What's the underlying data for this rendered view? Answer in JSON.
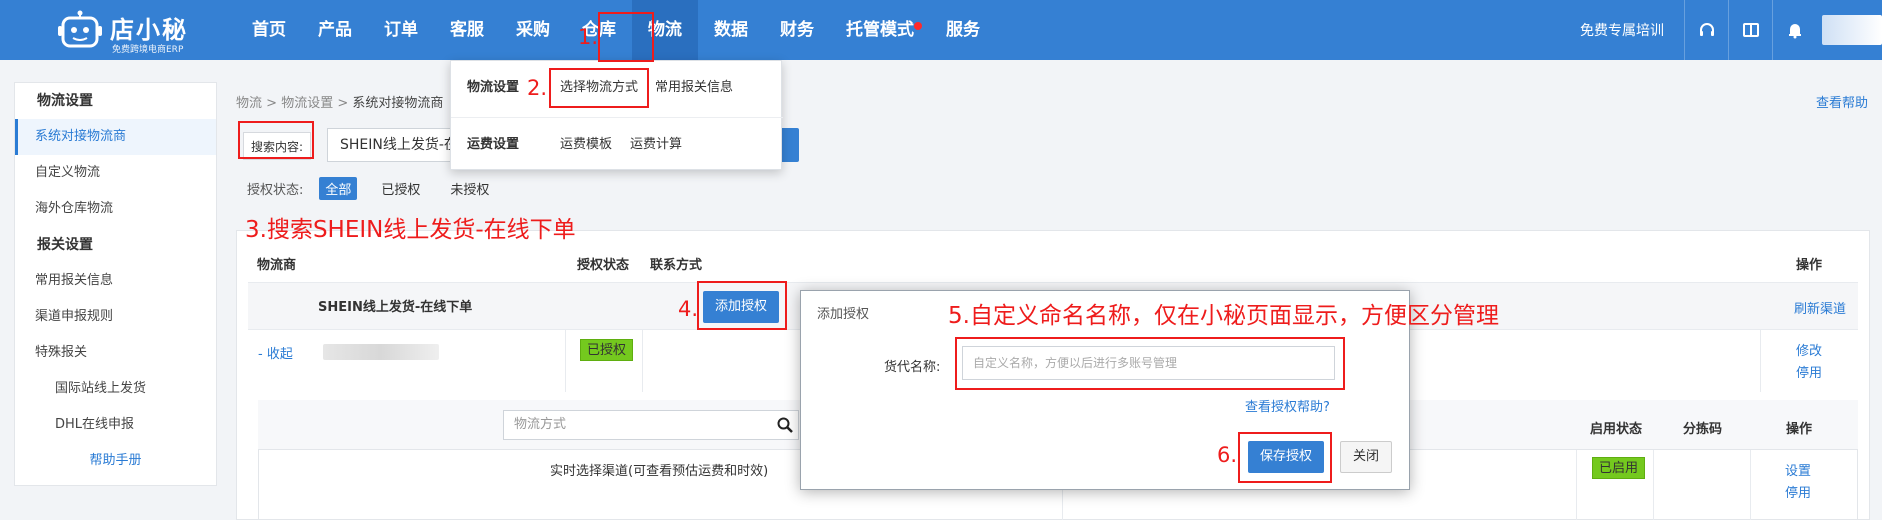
{
  "header": {
    "logo_text": "店小秘",
    "logo_sub": "免费跨境电商ERP",
    "nav": [
      "首页",
      "产品",
      "订单",
      "客服",
      "采购",
      "仓库",
      "物流",
      "数据",
      "财务",
      "托管模式",
      "服务"
    ],
    "active_nav": "物流",
    "free_training": "免费专属培训"
  },
  "dropdown": {
    "group1": "物流设置",
    "group1_items": [
      "选择物流方式",
      "常用报关信息"
    ],
    "group2": "运费设置",
    "group2_items": [
      "运费模板",
      "运费计算"
    ]
  },
  "sidebar": {
    "group1": "物流设置",
    "items1": [
      "系统对接物流商",
      "自定义物流",
      "海外仓库物流"
    ],
    "group2": "报关设置",
    "items2": [
      "常用报关信息",
      "渠道申报规则",
      "特殊报关"
    ],
    "subitems": [
      "国际站线上发货",
      "DHL在线申报"
    ],
    "help": "帮助手册"
  },
  "breadcrumb": [
    "物流",
    "物流设置",
    "系统对接物流商"
  ],
  "view_help": "查看帮助",
  "search": {
    "label": "搜索内容:",
    "value": "SHEIN线上发货-在"
  },
  "auth_filter": {
    "label": "授权状态:",
    "options": [
      "全部",
      "已授权",
      "未授权"
    ]
  },
  "table": {
    "headers": [
      "物流商",
      "授权状态",
      "联系方式",
      "操作"
    ],
    "provider": "SHEIN线上发货-在线下单",
    "add_auth": "添加授权",
    "refresh": "刷新渠道",
    "collapse": "- 收起",
    "authorized": "已授权",
    "edit": "修改",
    "stop": "停用"
  },
  "inner": {
    "method_placeholder": "物流方式",
    "headers": [
      "启用状态",
      "分拣码",
      "操作"
    ],
    "realtime": "实时选择渠道(可查看预估运费和时效)",
    "enabled": "已启用",
    "set": "设置",
    "stop": "停用"
  },
  "modal": {
    "title": "添加授权",
    "label": "货代名称:",
    "placeholder": "自定义名称，方便以后进行多账号管理",
    "help": "查看授权帮助?",
    "save": "保存授权",
    "close": "关闭"
  },
  "annotations": {
    "a1": "1.",
    "a2": "2.",
    "a3": "3.搜索SHEIN线上发货-在线下单",
    "a4": "4.",
    "a5": "5.自定义命名名称，仅在小秘页面显示，方便区分管理",
    "a6": "6."
  },
  "colors": {
    "brand": "#3580d3",
    "annotation": "#ee1c1c",
    "badge": "#74c91e"
  }
}
